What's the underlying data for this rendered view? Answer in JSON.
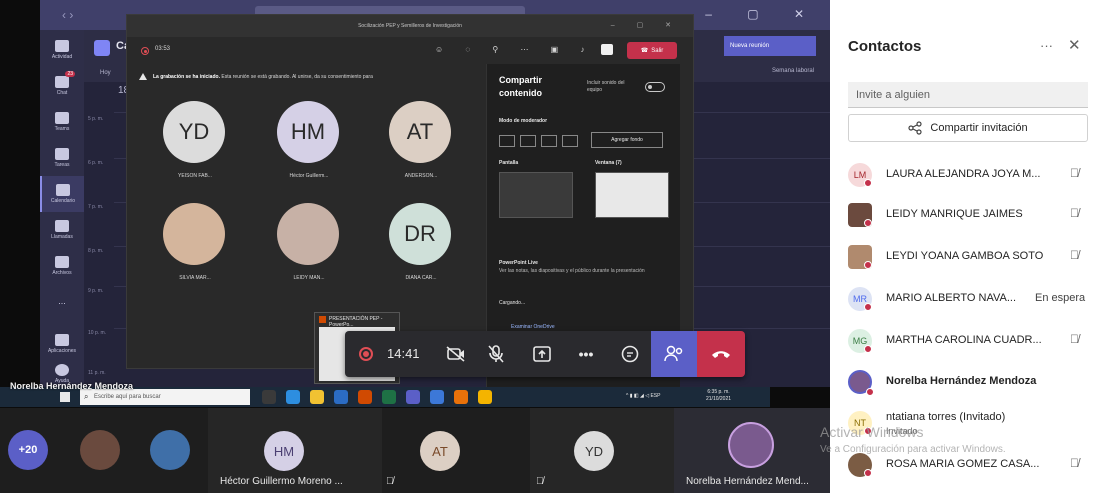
{
  "meeting": {
    "title": "Socilización PEP y Semilleros de Investigación",
    "timer": "03:53",
    "leave_label": "Salir",
    "recording_bold": "La grabación se ha iniciado.",
    "recording_text": "Esta reunión se está grabando. Al unirse, da su consentimiento para",
    "participants": [
      {
        "initials": "YD",
        "name": "YEISON FAB...",
        "bg": "#dcdcdc"
      },
      {
        "initials": "HM",
        "name": "Héctor Guillerm...",
        "bg": "#d5d0e6"
      },
      {
        "initials": "AT",
        "name": "ANDERSON...",
        "bg": "#dccfc4"
      },
      {
        "initials": "",
        "name": "SILVIA MAR...",
        "bg": "#d4b59c"
      },
      {
        "initials": "",
        "name": "LEIDY MAN...",
        "bg": "#c7b1a6"
      },
      {
        "initials": "DR",
        "name": "DIANA CAR...",
        "bg": "#cfe0d9"
      }
    ]
  },
  "calendar": {
    "title": "Calendario",
    "today": "Hoy",
    "day": "18",
    "new_meeting": "Nueva reunión",
    "view": "Semana laboral",
    "hours": [
      "5 p. m.",
      "6 p. m.",
      "7 p. m.",
      "8 p. m.",
      "9 p. m.",
      "10 p. m.",
      "11 p. m."
    ]
  },
  "teams_rail": [
    {
      "label": "Actividad",
      "badge": ""
    },
    {
      "label": "Chat",
      "badge": "23"
    },
    {
      "label": "Teams",
      "badge": ""
    },
    {
      "label": "Tareas",
      "badge": ""
    },
    {
      "label": "Calendario",
      "badge": ""
    },
    {
      "label": "Llamadas",
      "badge": ""
    },
    {
      "label": "Archivos",
      "badge": ""
    },
    {
      "label": "...",
      "badge": ""
    },
    {
      "label": "Aplicaciones",
      "badge": ""
    },
    {
      "label": "Ayuda",
      "badge": ""
    }
  ],
  "share_panel": {
    "title": "Compartir contenido",
    "include_sound": "Incluir sonido del equipo",
    "presenter_mode": "Modo de moderador",
    "add_background": "Agregar fondo",
    "screen": "Pantalla",
    "window": "Ventana (7)",
    "powerpoint_live": "PowerPoint Live",
    "powerpoint_desc": "Ver las notas, las diapositivas y el público durante la presentación",
    "loading": "Cargando...",
    "browse": "Examinar OneDrive"
  },
  "ppt_popup": {
    "title": "PRESENTACIÓN PEP - PowerPo..."
  },
  "controls": {
    "time": "14:41"
  },
  "taskbar": {
    "search_placeholder": "Escribe aquí para buscar",
    "lang": "ESP",
    "time": "6:35 p. m.",
    "date": "21/10/2021"
  },
  "presenter_name": "Norelba Hernández Mendoza",
  "strip": {
    "more_count": "+20",
    "items": [
      {
        "initials": "HM",
        "name": "Héctor Guillermo Moreno ..."
      },
      {
        "initials": "AT",
        "name": ""
      },
      {
        "initials": "YD",
        "name": ""
      },
      {
        "initials": "",
        "name": "Norelba Hernández Mend..."
      }
    ]
  },
  "contacts": {
    "title": "Contactos",
    "invite_placeholder": "Invite a alguien",
    "share_invite": "Compartir invitación",
    "people": [
      {
        "initials": "LM",
        "name": "LAURA ALEJANDRA JOYA M...",
        "status": "",
        "muted": true,
        "bg": "#f6d9da",
        "fg": "#a4262c"
      },
      {
        "initials": "",
        "name": "LEIDY MANRIQUE JAIMES",
        "status": "",
        "muted": true,
        "bg": "#6b4a3e",
        "fg": "#ffffff"
      },
      {
        "initials": "",
        "name": "LEYDI YOANA GAMBOA SOTO",
        "status": "",
        "muted": true,
        "bg": "#b08a6e",
        "fg": "#ffffff"
      },
      {
        "initials": "MR",
        "name": "MARIO ALBERTO NAVA...",
        "status": "En espera",
        "muted": false,
        "bg": "#dde3f4",
        "fg": "#4f6bed"
      },
      {
        "initials": "MG",
        "name": "MARTHA CAROLINA CUADR...",
        "status": "",
        "muted": true,
        "bg": "#dcf0e3",
        "fg": "#3a7d44"
      },
      {
        "initials": "",
        "name": "Norelba Hernández Mendoza",
        "status": "",
        "muted": false,
        "bg": "#7a5a8e",
        "fg": "#ffffff"
      },
      {
        "initials": "NT",
        "name": "ntatiana torres (Invitado)",
        "status": "",
        "muted": false,
        "bg": "#fff1c2",
        "fg": "#8a6d00"
      },
      {
        "initials": "",
        "name": "ROSA MARIA GOMEZ CASA...",
        "status": "",
        "muted": true,
        "bg": "#7b5c44",
        "fg": "#ffffff"
      }
    ],
    "invited_sub": "Invitado"
  },
  "windows_watermark": {
    "line1": "Activar Windows",
    "line2": "Ve a Configuración para activar Windows."
  }
}
